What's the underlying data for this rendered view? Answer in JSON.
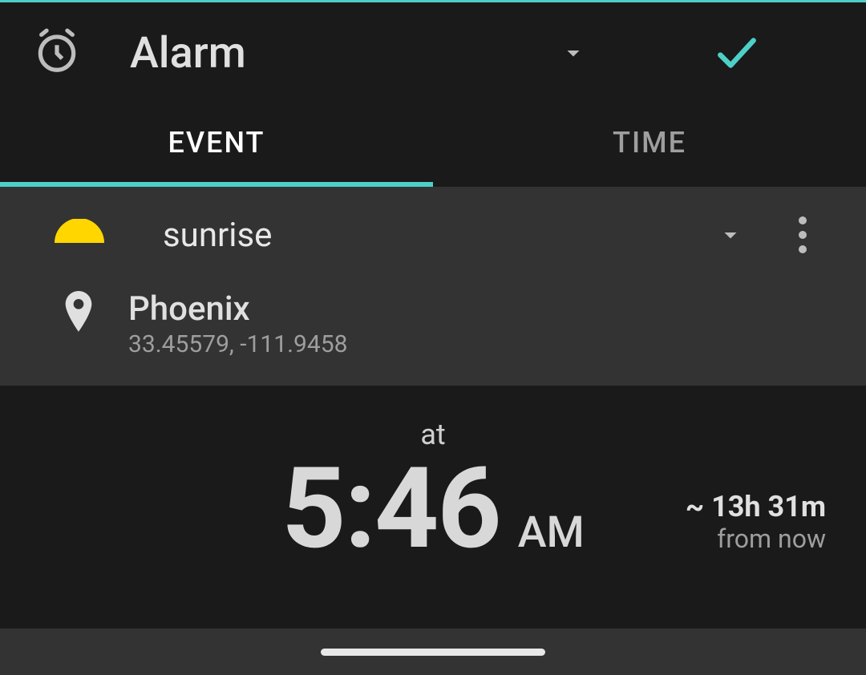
{
  "header": {
    "title": "Alarm"
  },
  "tabs": {
    "event": "EVENT",
    "time": "TIME"
  },
  "event": {
    "name": "sunrise",
    "location_name": "Phoenix",
    "location_coords": "33.45579, -111.9458"
  },
  "time": {
    "at_label": "at",
    "value": "5:46",
    "ampm": "AM",
    "countdown": "~ 13h 31m",
    "countdown_label": "from now"
  },
  "colors": {
    "accent": "#4dd0c7",
    "sunrise": "#ffd600"
  }
}
